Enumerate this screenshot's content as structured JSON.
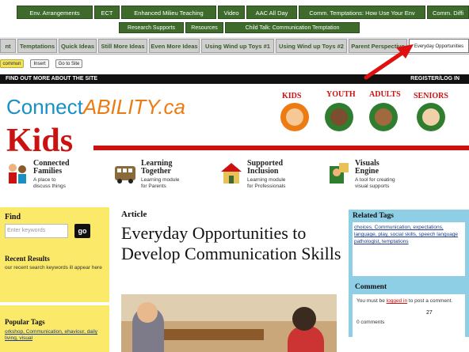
{
  "tabs_row1": [
    "Env. Arrangements",
    "ECT",
    "Enhanced Milieu Teaching",
    "Video",
    "AAC All Day",
    "Comm. Temptations: How Use Your Env",
    "Comm. Diffi"
  ],
  "tabs_row2": [
    "Research Supports",
    "Resources",
    "Child Talk: Communication Temptation"
  ],
  "tabs_row3": [
    "nt",
    "Temptations",
    "Quick Ideas",
    "Still More Ideas",
    "Even More Ideas",
    "Using Wind up Toys #1",
    "Using Wind up Toys #2",
    "Parent Perspective",
    "Everyday Opportunities"
  ],
  "toolbar": {
    "btn1": "commun",
    "btn2": "Insert",
    "btn3": "Go to Site"
  },
  "site": {
    "find_out": "FIND OUT MORE ABOUT THE SITE",
    "register": "REGISTER/LOG IN",
    "logo_connect": "Connect",
    "logo_ability": "ABILITY.ca",
    "kids": "Kids",
    "age_groups": [
      "KIDS",
      "YOUTH",
      "ADULTS",
      "SENIORS"
    ]
  },
  "features": [
    {
      "title1": "Connected",
      "title2": "Families",
      "sub1": "A place to",
      "sub2": "discuss things"
    },
    {
      "title1": "Learning",
      "title2": "Together",
      "sub1": "Learning module",
      "sub2": "for Parents"
    },
    {
      "title1": "Supported",
      "title2": "Inclusion",
      "sub1": "Learning module",
      "sub2": "for Professionals"
    },
    {
      "title1": "Visuals",
      "title2": "Engine",
      "sub1": "A tool for creating",
      "sub2": "visual supports"
    }
  ],
  "left": {
    "find": "Find",
    "search_placeholder": "Enter keywords",
    "go": "go",
    "recent_title": "Recent Results",
    "recent_text": "our recent search keywords ill appear here",
    "popular_title": "Popular Tags",
    "popular_text": "orkshop, Communication, ehaviour, daily living, visual"
  },
  "article": {
    "kicker": "Article",
    "title": "Everyday Opportunities to Develop Communication Skills"
  },
  "right": {
    "related_title": "Related Tags",
    "related_tags": "choices, Communication, expectations, language, play, social skills, speech language pathologist, temptations",
    "comment_title": "Comment",
    "comment_pre": "You must be ",
    "comment_link": "logged in",
    "comment_post": " to post a comment.",
    "comment_count": "0 comments"
  },
  "page_number": "27",
  "colors": {
    "tab_green": "#3e6b2c",
    "accent_red": "#cc1111",
    "logo_blue": "#1a8fc4",
    "yellow_box": "#fbe96a",
    "blue_box": "#8ecfe6"
  }
}
